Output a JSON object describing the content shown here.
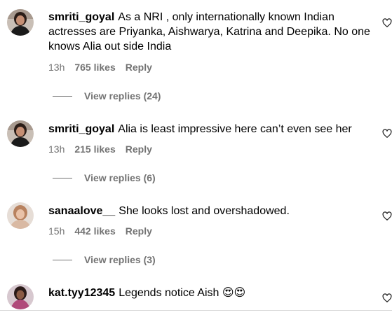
{
  "comments": [
    {
      "username": "smriti_goyal",
      "text": "As a NRI , only internationally known Indian actresses are Priyanka, Aishwarya, Katrina and Deepika. No one knows Alia out side India",
      "time": "13h",
      "likes": "765 likes",
      "reply": "Reply",
      "view_replies": "View replies (24)"
    },
    {
      "username": "smriti_goyal",
      "text": "Alia is least impressive here can’t even see her",
      "time": "13h",
      "likes": "215 likes",
      "reply": "Reply",
      "view_replies": "View replies (6)"
    },
    {
      "username": "sanaalove__",
      "text": "She looks lost and overshadowed.",
      "time": "15h",
      "likes": "442 likes",
      "reply": "Reply",
      "view_replies": "View replies (3)"
    },
    {
      "username": "kat.tyy12345",
      "text": "Legends notice Aish 😍😍"
    }
  ],
  "icons": {
    "like": "heart-outline-icon"
  }
}
